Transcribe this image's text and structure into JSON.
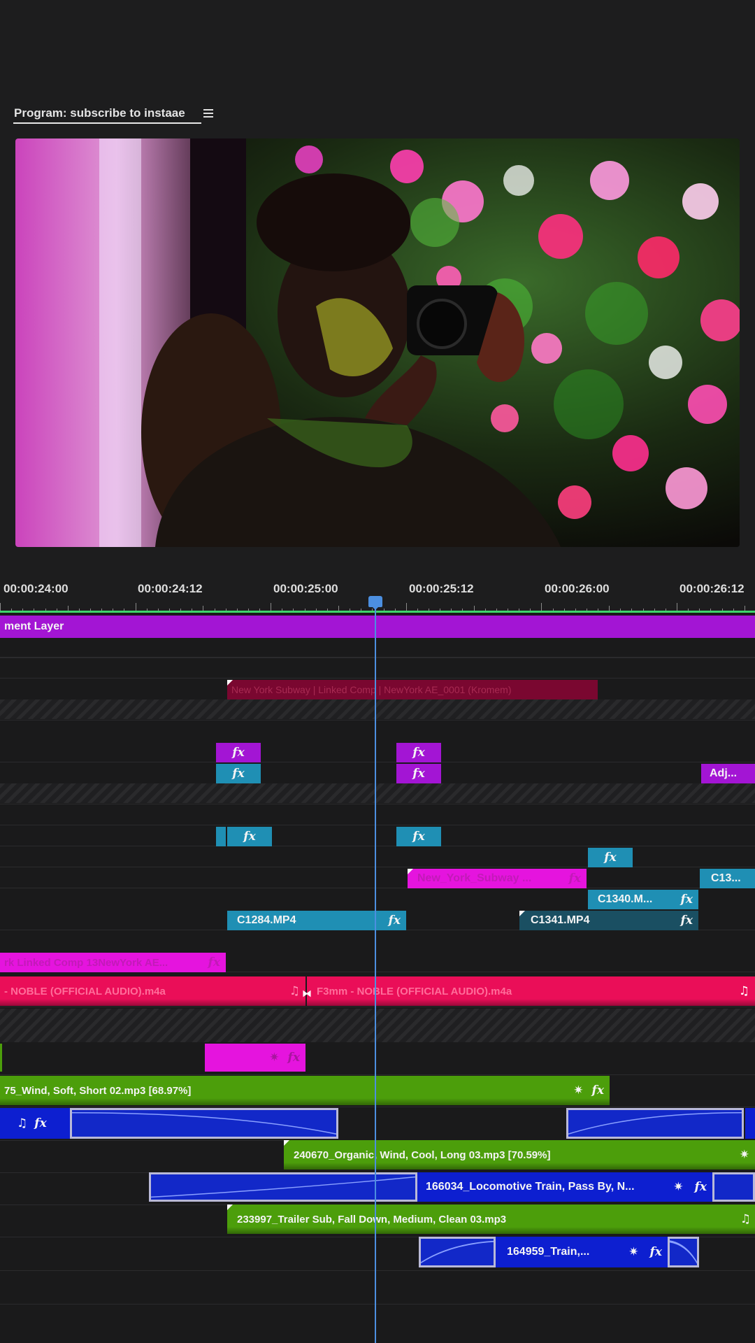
{
  "program_panel": {
    "title": "Program: subscribe to instaae",
    "menu_icon": "hamburger-menu-icon"
  },
  "program_monitor": {
    "description_icon": "video-frame"
  },
  "ruler": {
    "labels": [
      "00:00:24:00",
      "00:00:24:12",
      "00:00:25:00",
      "00:00:25:12",
      "00:00:26:00",
      "00:00:26:12"
    ]
  },
  "tracks": {
    "adjustment_layer": {
      "label": "ment Layer"
    },
    "title_clip": {
      "label": "New York Subway | Linked Comp | NewYork AE_0001 (Kromem)"
    },
    "fx_icon": "fx",
    "adj_clip": {
      "label": "Adj..."
    },
    "subway_clip": {
      "label": "New_York_Subway ..."
    },
    "c13_clip": {
      "label": "C13..."
    },
    "c1340_clip": {
      "label": "C1340.M..."
    },
    "c1284_clip": {
      "label": "C1284.MP4"
    },
    "c1341_clip": {
      "label": "C1341.MP4"
    },
    "linked_comp_clip": {
      "label": "rk Linked Comp 13NewYork AE..."
    },
    "music_clip_a": {
      "label": "- NOBLE (OFFICIAL AUDIO).m4a"
    },
    "music_clip_b": {
      "label": "F3mm - NOBLE (OFFICIAL AUDIO).m4a"
    },
    "wind_clip": {
      "label": "75_Wind, Soft, Short 02.mp3 [68.97%]"
    },
    "organic_clip": {
      "label": "240670_Organic, Wind, Cool, Long 03.mp3 [70.59%]"
    },
    "locomotive_clip": {
      "label": "166034_Locomotive Train, Pass By, N..."
    },
    "trailer_clip": {
      "label": "233997_Trailer Sub, Fall Down, Medium, Clean 03.mp3"
    },
    "train_clip": {
      "label": "164959_Train,..."
    },
    "music_icon": "♫",
    "effect_icon": "✷"
  },
  "colors": {
    "video_purple": "#a315d4",
    "video_teal": "#1f8fb4",
    "audio_red": "#ea0e58",
    "audio_green": "#4c9e0b",
    "audio_blue": "#1228c8",
    "playhead": "#4c8fe0",
    "work_area": "#3ed46b"
  }
}
